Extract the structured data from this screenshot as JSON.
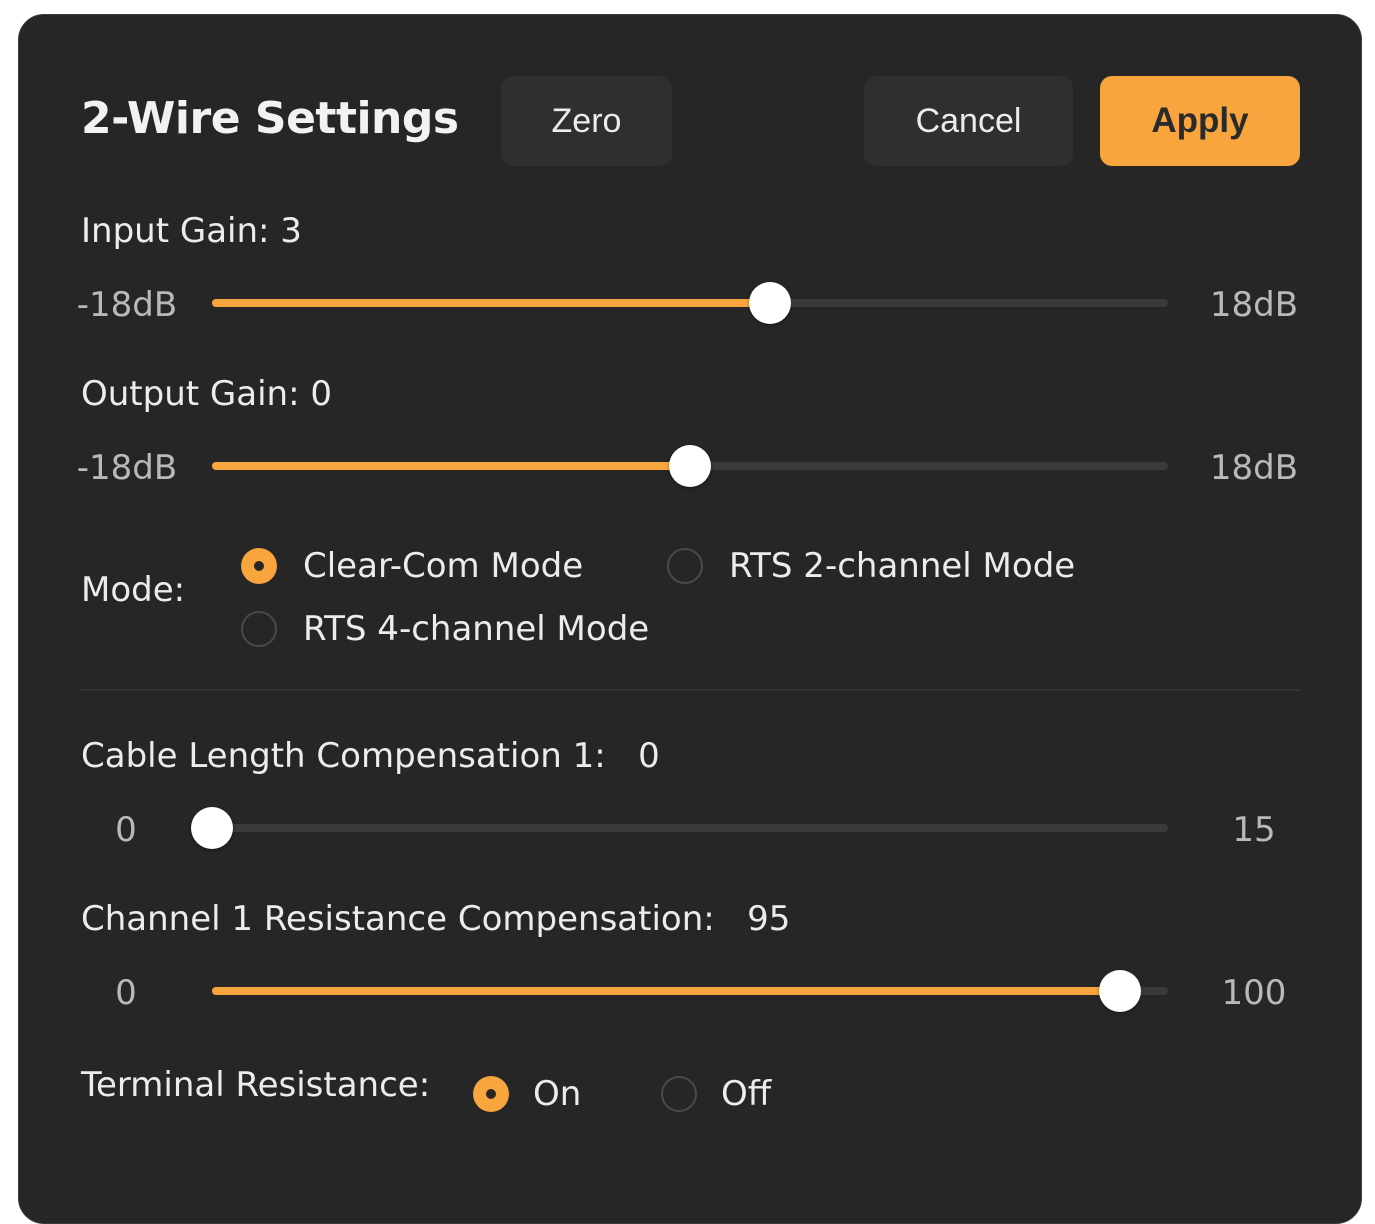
{
  "dialog": {
    "title": "2-Wire Settings",
    "buttons": {
      "zero": "Zero",
      "cancel": "Cancel",
      "apply": "Apply"
    }
  },
  "input_gain": {
    "label": "Input Gain: 3",
    "min_label": "-18dB",
    "max_label": "18dB",
    "min": -18,
    "max": 18,
    "value": 3
  },
  "output_gain": {
    "label": "Output Gain: 0",
    "min_label": "-18dB",
    "max_label": "18dB",
    "min": -18,
    "max": 18,
    "value": 0
  },
  "mode": {
    "label": "Mode:",
    "options": [
      {
        "label": "Clear-Com Mode",
        "checked": true
      },
      {
        "label": "RTS 2-channel Mode",
        "checked": false
      },
      {
        "label": "RTS 4-channel Mode",
        "checked": false
      }
    ]
  },
  "cable_length": {
    "label": "Cable Length Compensation 1:   0",
    "min_label": "0",
    "max_label": "15",
    "min": 0,
    "max": 15,
    "value": 0
  },
  "resistance": {
    "label": "Channel 1 Resistance Compensation:   95",
    "min_label": "0",
    "max_label": "100",
    "min": 0,
    "max": 100,
    "value": 95
  },
  "terminal_resistance": {
    "label": "Terminal Resistance:",
    "options": [
      {
        "label": "On",
        "checked": true
      },
      {
        "label": "Off",
        "checked": false
      }
    ]
  },
  "colors": {
    "background": "#262627",
    "accent": "#f7a53c",
    "track": "#3a3a3c",
    "text": "#ececec"
  }
}
